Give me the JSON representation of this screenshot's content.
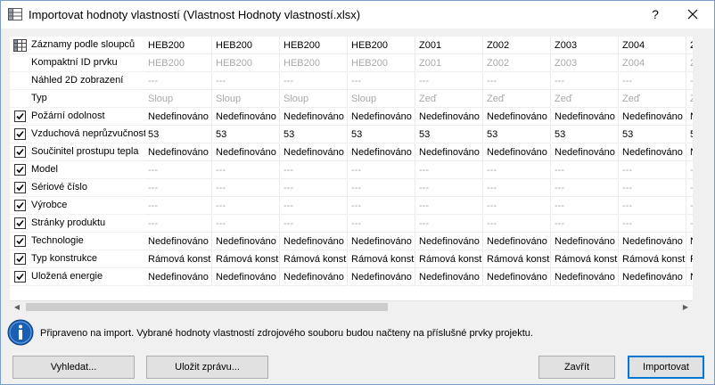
{
  "window": {
    "title": "Importovat hodnoty vlastností (Vlastnost Hodnoty vlastností.xlsx)",
    "help_label": "?",
    "close_label": "✕"
  },
  "grid": {
    "header_label": "Záznamy podle sloupců",
    "columns": [
      "HEB200",
      "HEB200",
      "HEB200",
      "HEB200",
      "Z001",
      "Z002",
      "Z003",
      "Z004",
      "2"
    ],
    "rows": [
      {
        "label": "Kompaktní ID prvku",
        "checkbox": false,
        "checked": false,
        "grey": true,
        "values": [
          "HEB200",
          "HEB200",
          "HEB200",
          "HEB200",
          "Z001",
          "Z002",
          "Z003",
          "Z004",
          "2"
        ]
      },
      {
        "label": "Náhled 2D zobrazení",
        "checkbox": false,
        "checked": false,
        "grey": true,
        "values": [
          "---",
          "---",
          "---",
          "---",
          "---",
          "---",
          "---",
          "---",
          "-"
        ]
      },
      {
        "label": "Typ",
        "checkbox": false,
        "checked": false,
        "grey": true,
        "values": [
          "Sloup",
          "Sloup",
          "Sloup",
          "Sloup",
          "Zeď",
          "Zeď",
          "Zeď",
          "Zeď",
          "Z"
        ]
      },
      {
        "label": "Požární odolnost",
        "checkbox": true,
        "checked": true,
        "grey": false,
        "values": [
          "Nedefinováno",
          "Nedefinováno",
          "Nedefinováno",
          "Nedefinováno",
          "Nedefinováno",
          "Nedefinováno",
          "Nedefinováno",
          "Nedefinováno",
          "N"
        ]
      },
      {
        "label": "Vzduchová neprůzvučnost",
        "checkbox": true,
        "checked": true,
        "grey": false,
        "values": [
          "53",
          "53",
          "53",
          "53",
          "53",
          "53",
          "53",
          "53",
          "5"
        ]
      },
      {
        "label": "Součinitel prostupu tepla",
        "checkbox": true,
        "checked": true,
        "grey": false,
        "values": [
          "Nedefinováno",
          "Nedefinováno",
          "Nedefinováno",
          "Nedefinováno",
          "Nedefinováno",
          "Nedefinováno",
          "Nedefinováno",
          "Nedefinováno",
          "N"
        ]
      },
      {
        "label": "Model",
        "checkbox": true,
        "checked": true,
        "grey": true,
        "values": [
          "---",
          "---",
          "---",
          "---",
          "---",
          "---",
          "---",
          "---",
          "-"
        ]
      },
      {
        "label": "Sériové číslo",
        "checkbox": true,
        "checked": true,
        "grey": true,
        "values": [
          "---",
          "---",
          "---",
          "---",
          "---",
          "---",
          "---",
          "---",
          "-"
        ]
      },
      {
        "label": "Výrobce",
        "checkbox": true,
        "checked": true,
        "grey": true,
        "values": [
          "---",
          "---",
          "---",
          "---",
          "---",
          "---",
          "---",
          "---",
          "-"
        ]
      },
      {
        "label": "Stránky produktu",
        "checkbox": true,
        "checked": true,
        "grey": true,
        "values": [
          "---",
          "---",
          "---",
          "---",
          "---",
          "---",
          "---",
          "---",
          "-"
        ]
      },
      {
        "label": "Technologie",
        "checkbox": true,
        "checked": true,
        "grey": false,
        "values": [
          "Nedefinováno",
          "Nedefinováno",
          "Nedefinováno",
          "Nedefinováno",
          "Nedefinováno",
          "Nedefinováno",
          "Nedefinováno",
          "Nedefinováno",
          "N"
        ]
      },
      {
        "label": "Typ konstrukce",
        "checkbox": true,
        "checked": true,
        "grey": false,
        "values": [
          "Rámová konst",
          "Rámová konst",
          "Rámová konst",
          "Rámová konst",
          "Rámová konst",
          "Rámová konst",
          "Rámová konst",
          "Rámová konst",
          "F"
        ]
      },
      {
        "label": "Uložená energie",
        "checkbox": true,
        "checked": true,
        "grey": false,
        "values": [
          "Nedefinováno",
          "Nedefinováno",
          "Nedefinováno",
          "Nedefinováno",
          "Nedefinováno",
          "Nedefinováno",
          "Nedefinováno",
          "Nedefinováno",
          "N"
        ]
      }
    ]
  },
  "status": {
    "message": "Připraveno na import. Vybrané hodnoty vlastností zdrojového souboru budou načteny na příslušné prvky projektu."
  },
  "buttons": {
    "find": "Vyhledat...",
    "save_report": "Uložit zprávu...",
    "close": "Zavřít",
    "import": "Importovat"
  },
  "colors": {
    "info_blue": "#1a5fb4",
    "checkbox_border": "#333333"
  }
}
